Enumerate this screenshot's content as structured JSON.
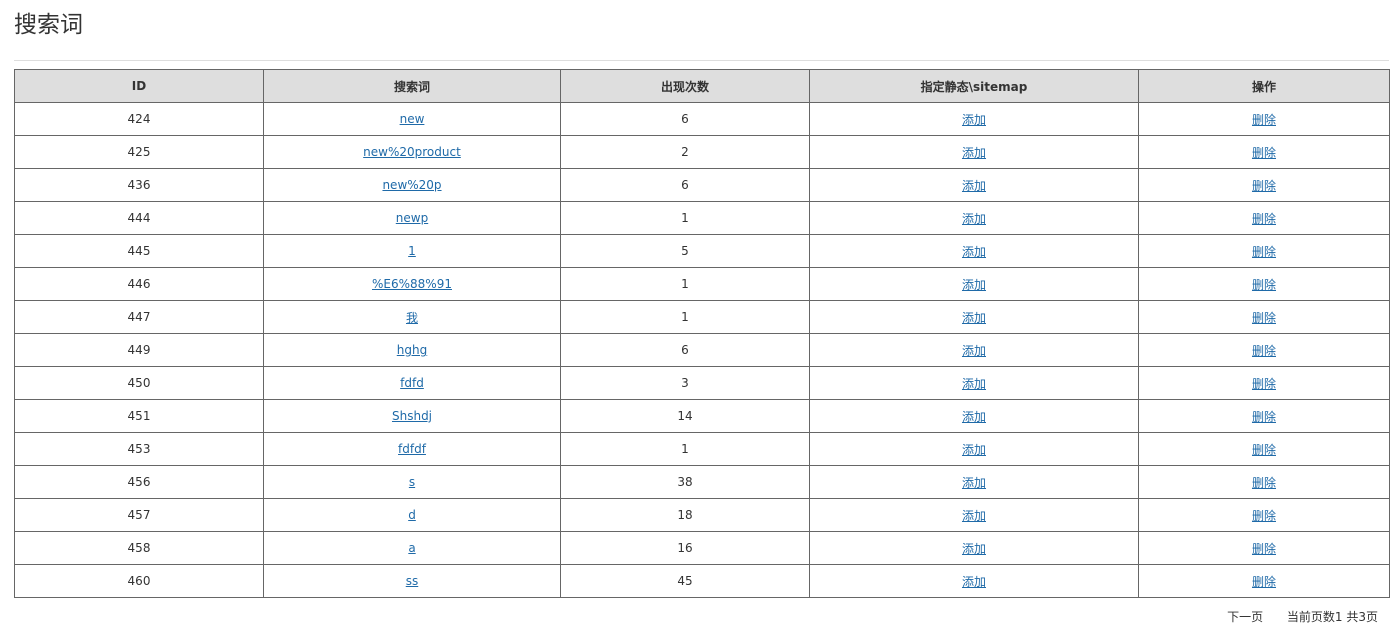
{
  "page": {
    "title": "搜索词"
  },
  "table": {
    "headers": {
      "id": "ID",
      "keyword": "搜索词",
      "count": "出现次数",
      "static": "指定静态\\sitemap",
      "action": "操作"
    },
    "add_label": "添加",
    "delete_label": "删除",
    "rows": [
      {
        "id": "424",
        "keyword": "new",
        "count": "6"
      },
      {
        "id": "425",
        "keyword": "new%20product",
        "count": "2"
      },
      {
        "id": "436",
        "keyword": "new%20p",
        "count": "6"
      },
      {
        "id": "444",
        "keyword": "newp",
        "count": "1"
      },
      {
        "id": "445",
        "keyword": "1",
        "count": "5"
      },
      {
        "id": "446",
        "keyword": "%E6%88%91",
        "count": "1"
      },
      {
        "id": "447",
        "keyword": "我",
        "count": "1"
      },
      {
        "id": "449",
        "keyword": "hghg",
        "count": "6"
      },
      {
        "id": "450",
        "keyword": "fdfd",
        "count": "3"
      },
      {
        "id": "451",
        "keyword": "Shshdj",
        "count": "14"
      },
      {
        "id": "453",
        "keyword": "fdfdf",
        "count": "1"
      },
      {
        "id": "456",
        "keyword": "s",
        "count": "38"
      },
      {
        "id": "457",
        "keyword": "d",
        "count": "18"
      },
      {
        "id": "458",
        "keyword": "a",
        "count": "16"
      },
      {
        "id": "460",
        "keyword": "ss",
        "count": "45"
      }
    ]
  },
  "pager": {
    "next_label": "下一页",
    "status": "当前页数1 共3页"
  }
}
